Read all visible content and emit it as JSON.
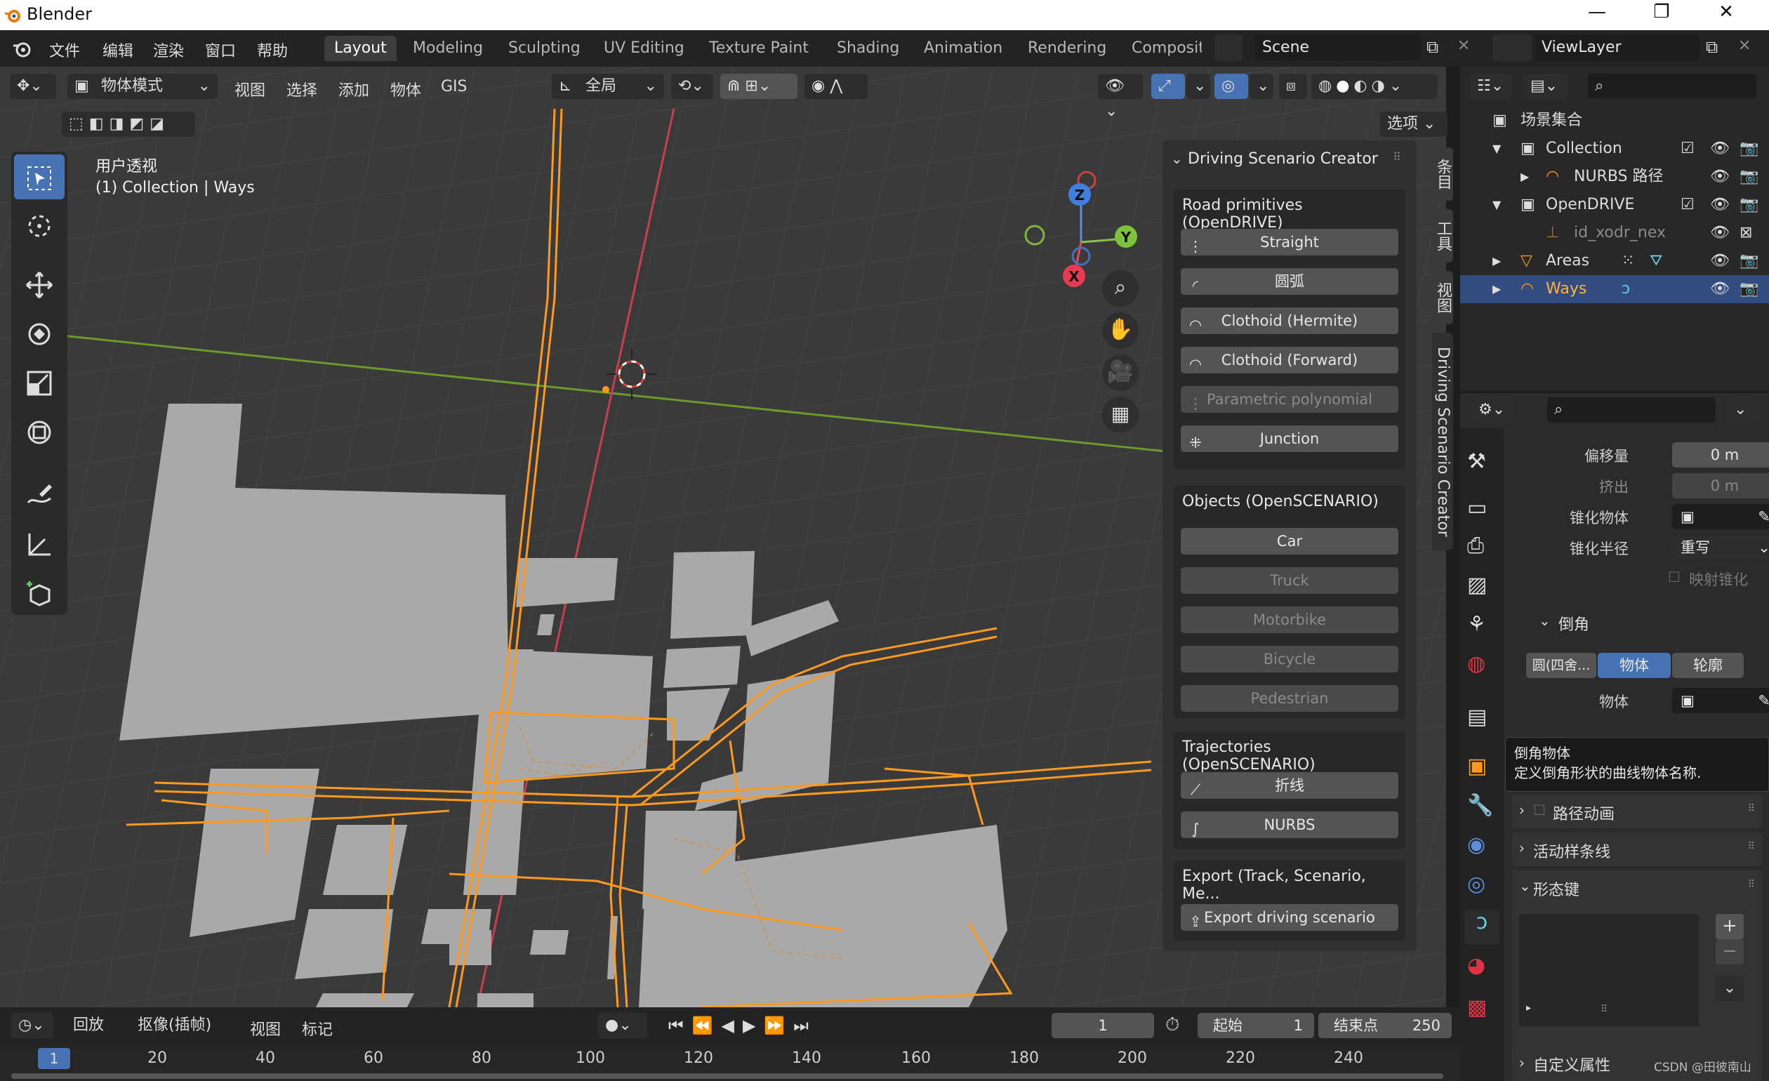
{
  "titlebar": {
    "app": "Blender",
    "min": "—",
    "max": "❐",
    "close": "✕"
  },
  "menu": [
    "文件",
    "编辑",
    "渲染",
    "窗口",
    "帮助"
  ],
  "workspaces": [
    {
      "label": "Layout",
      "active": true
    },
    {
      "label": "Modeling"
    },
    {
      "label": "Sculpting"
    },
    {
      "label": "UV Editing"
    },
    {
      "label": "Texture Paint"
    },
    {
      "label": "Shading"
    },
    {
      "label": "Animation"
    },
    {
      "label": "Rendering"
    },
    {
      "label": "Composit"
    }
  ],
  "scene": {
    "label": "Scene",
    "viewlayer": "ViewLayer"
  },
  "viewport": {
    "mode": "物体模式",
    "menus": [
      "视图",
      "选择",
      "添加",
      "物体",
      "GIS"
    ],
    "orientation": "全局",
    "options_label": "选项",
    "overlay_title": "用户透视",
    "overlay_sub": "(1) Collection | Ways",
    "gizmo": {
      "x": "X",
      "y": "Y",
      "z": "Z"
    }
  },
  "npanel": {
    "title": "Driving Scenario Creator",
    "tabs": [
      "条目",
      "工具",
      "视图",
      "Driving Scenario Creator"
    ],
    "road_title": "Road primitives (OpenDRIVE)",
    "road_buttons": [
      {
        "label": "Straight",
        "enabled": true
      },
      {
        "label": "圆弧",
        "enabled": true
      },
      {
        "label": "Clothoid (Hermite)",
        "enabled": true
      },
      {
        "label": "Clothoid (Forward)",
        "enabled": true
      },
      {
        "label": "Parametric polynomial",
        "enabled": false
      },
      {
        "label": "Junction",
        "enabled": true
      }
    ],
    "objects_title": "Objects (OpenSCENARIO)",
    "object_buttons": [
      {
        "label": "Car",
        "enabled": true
      },
      {
        "label": "Truck",
        "enabled": false
      },
      {
        "label": "Motorbike",
        "enabled": false
      },
      {
        "label": "Bicycle",
        "enabled": false
      },
      {
        "label": "Pedestrian",
        "enabled": false
      }
    ],
    "traj_title": "Trajectories (OpenSCENARIO)",
    "traj_buttons": [
      {
        "label": "折线"
      },
      {
        "label": "NURBS"
      }
    ],
    "export_title": "Export (Track, Scenario, Me...",
    "export_button": "Export driving scenario"
  },
  "outliner": {
    "root": "场景集合",
    "rows": [
      {
        "label": "Collection",
        "indent": 1,
        "expanded": true
      },
      {
        "label": "NURBS 路径",
        "indent": 2
      },
      {
        "label": "OpenDRIVE",
        "indent": 1,
        "expanded": true
      },
      {
        "label": "id_xodr_nex",
        "indent": 2,
        "dim": true
      },
      {
        "label": "Areas",
        "indent": 1
      },
      {
        "label": "Ways",
        "indent": 1,
        "selected": true
      }
    ]
  },
  "properties": {
    "offset_label": "偏移量",
    "offset_value": "0 m",
    "extrude_label": "挤出",
    "extrude_value": "0 m",
    "taper_obj_label": "锥化物体",
    "taper_radius_label": "锥化半径",
    "taper_radius_value": "重写",
    "map_taper": "映射锥化",
    "bevel_label": "倒角",
    "bevel_modes": [
      "圆(四舍...",
      "物体",
      "轮廓"
    ],
    "bevel_obj_label": "物体",
    "tooltip_title": "倒角物体",
    "tooltip_body": "定义倒角形状的曲线物体名称.",
    "path_anim": "路径动画",
    "active_spline": "活动样条线",
    "shape_keys": "形态键",
    "custom_props": "自定义属性"
  },
  "timeline": {
    "playback": "回放",
    "keying": "抠像(插帧)",
    "view": "视图",
    "marker": "标记",
    "current_frame": "1",
    "start_label": "起始",
    "start": "1",
    "end_label": "结束点",
    "end": "250",
    "ruler": [
      "1",
      "20",
      "40",
      "60",
      "80",
      "100",
      "120",
      "140",
      "160",
      "180",
      "200",
      "220",
      "240"
    ]
  },
  "watermark": "CSDN @田彼南山",
  "colors": {
    "accent": "#4772b3",
    "road": "#ff9a1f",
    "building": "#a8a8a8",
    "grid": "#3f3f3f"
  }
}
